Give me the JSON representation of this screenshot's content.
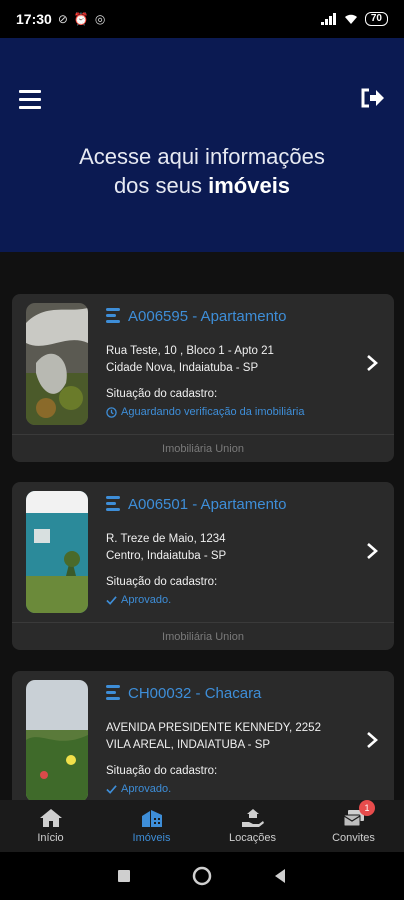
{
  "status_bar": {
    "time": "17:30",
    "battery": "70"
  },
  "header": {
    "title_line1": "Acesse aqui informações",
    "title_line2_prefix": "dos seus ",
    "title_line2_bold": "imóveis"
  },
  "properties": [
    {
      "code": "A006595 - Apartamento",
      "address_line1": "Rua Teste, 10 , Bloco 1 - Apto 21",
      "address_line2": "Cidade Nova, Indaiatuba - SP",
      "status_label": "Situação do cadastro:",
      "status_value": "Aguardando verificação da imobiliária",
      "agency": "Imobiliária Union"
    },
    {
      "code": "A006501 - Apartamento",
      "address_line1": "R. Treze de Maio, 1234",
      "address_line2": "Centro, Indaiatuba - SP",
      "status_label": "Situação do cadastro:",
      "status_value": "Aprovado.",
      "agency": "Imobiliária Union"
    },
    {
      "code": "CH00032 - Chacara",
      "address_line1": "AVENIDA PRESIDENTE KENNEDY, 2252",
      "address_line2": "VILA AREAL, INDAIATUBA - SP",
      "status_label": "Situação do cadastro:",
      "status_value": "Aprovado."
    }
  ],
  "tabs": [
    {
      "label": "Início"
    },
    {
      "label": "Imóveis"
    },
    {
      "label": "Locações"
    },
    {
      "label": "Convites",
      "badge": "1"
    }
  ],
  "colors": {
    "header_bg": "#0b1a52",
    "accent": "#3e8ed8",
    "card_bg": "#2a2a2a",
    "badge": "#e74c4c"
  }
}
